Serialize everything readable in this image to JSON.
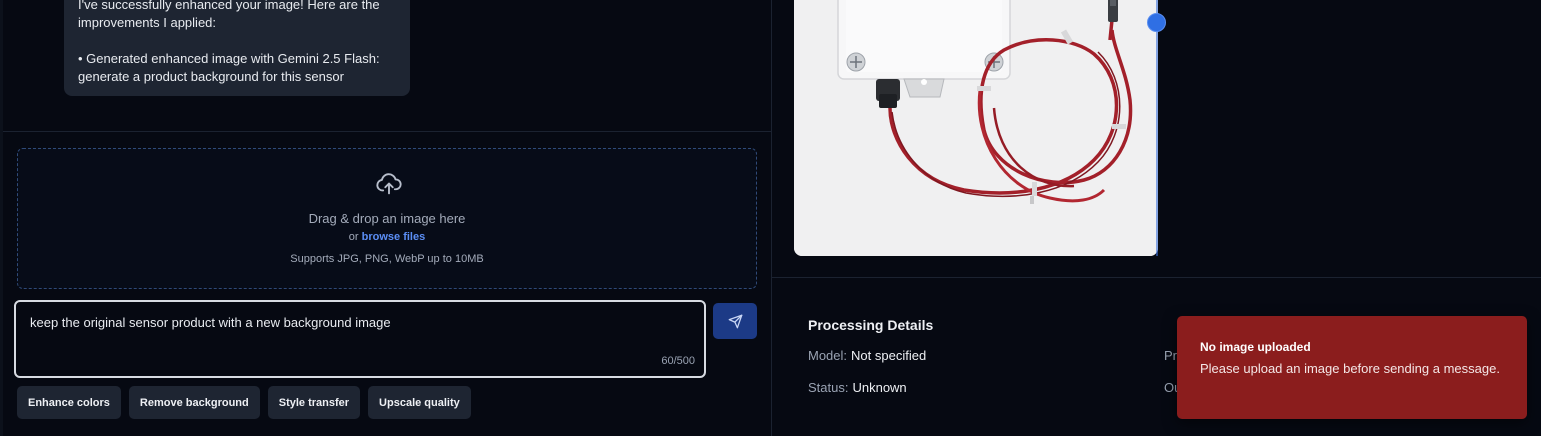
{
  "chat": {
    "assistant_message": {
      "line1": "I've successfully enhanced your image! Here are the",
      "line2": "improvements I applied:",
      "line3": "• Generated enhanced image with Gemini 2.5 Flash:",
      "line4": "generate a product background for this sensor"
    }
  },
  "upload": {
    "title": "Drag & drop an image here",
    "or_text": "or",
    "browse_label": "browse files",
    "note": "Supports JPG, PNG, WebP up to 10MB"
  },
  "prompt": {
    "value": "keep the original sensor product with a new background image",
    "counter": "60/500"
  },
  "quick_actions": [
    "Enhance colors",
    "Remove background",
    "Style transfer",
    "Upscale quality"
  ],
  "details": {
    "title": "Processing Details",
    "model_label": "Model:",
    "model_value": "Not specified",
    "status_label": "Status:",
    "status_value": "Unknown",
    "right_label_1": "Pr",
    "right_label_2": "Ou"
  },
  "toast": {
    "title": "No image uploaded",
    "message": "Please upload an image before sending a message."
  },
  "colors": {
    "accent": "#2f6fe4",
    "toast_bg": "#8b1d1d",
    "send_button": "#1c3a86"
  }
}
